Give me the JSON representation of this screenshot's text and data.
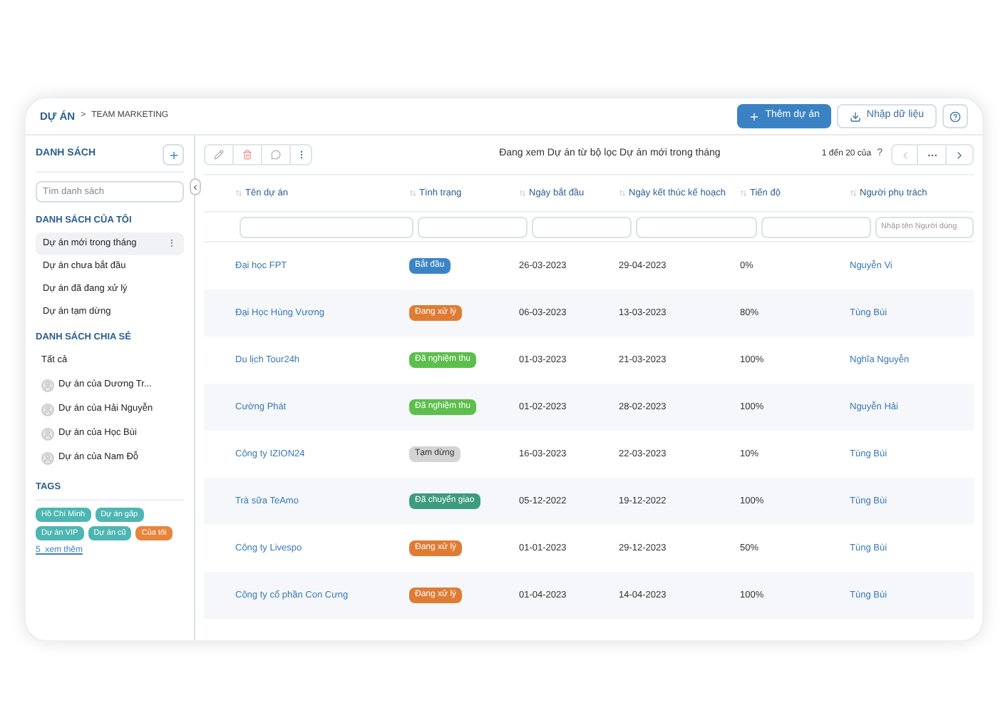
{
  "breadcrumb": {
    "parent": "DỰ ÁN",
    "separator": ">",
    "current": "TEAM MARKETING"
  },
  "header_buttons": [
    {
      "label": "Thêm dự án",
      "kind": "primary"
    },
    {
      "label": "Nhập dữ liệu",
      "kind": "import"
    }
  ],
  "sidebar": {
    "title": "DANH SÁCH",
    "search": {
      "placeholder": "Tìm danh sách"
    },
    "my_lists": {
      "title": "DANH SÁCH CỦA TÔI",
      "items": [
        {
          "label": "Dự án mới trong tháng",
          "selected": true
        },
        {
          "label": "Dự án chưa bắt đầu",
          "selected": false
        },
        {
          "label": "Dự án đã đang xử lý",
          "selected": false
        },
        {
          "label": "Dự án tạm dừng",
          "selected": false
        }
      ]
    },
    "shared_lists": {
      "title": "DANH SÁCH CHIA SẺ",
      "items": [
        {
          "label": "Tất cả",
          "kind": "all"
        },
        {
          "label": "Dự án của Dương Tr...",
          "kind": "user"
        },
        {
          "label": "Dự án của Hải Nguyễn",
          "kind": "user"
        },
        {
          "label": "Dự án của Học Bùi",
          "kind": "user"
        },
        {
          "label": "Dự án của Nam Đỗ",
          "kind": "user"
        }
      ]
    },
    "tags": {
      "title": "TAGS",
      "items": [
        {
          "label": "Hồ Chí Minh",
          "color": "#4db6b2"
        },
        {
          "label": "Dự án gấp",
          "color": "#4db6b2"
        },
        {
          "label": "Dự án VIP",
          "color": "#4db6b2"
        },
        {
          "label": "Dự án cũ",
          "color": "#4db6b2"
        },
        {
          "label": "Của tôi",
          "color": "#e8843c"
        }
      ],
      "more_link": "5  xem thêm"
    }
  },
  "toolbar": {
    "filter_text": "Đang xem Dự án từ bộ lọc Dự án mới trong tháng",
    "pagination": "1 đến 20 của",
    "total": "?"
  },
  "table": {
    "columns": [
      {
        "label": "Tên dự án"
      },
      {
        "label": "Tình trạng"
      },
      {
        "label": "Ngày bắt đầu"
      },
      {
        "label": "Ngày kết thúc kế hoạch"
      },
      {
        "label": "Tiến độ"
      },
      {
        "label": "Người phụ trách",
        "filter_placeholder": "Nhập tên Người dùng"
      }
    ],
    "rows": [
      {
        "name": "Đại học FPT",
        "status": "Bắt đầu",
        "color": "#3b85c6",
        "start": "26-03-2023",
        "end": "29-04-2023",
        "progress": "0%",
        "owner": "Nguyễn Vi"
      },
      {
        "name": "Đại Học Hùng Vương",
        "status": "Đang xử lý",
        "color": "#e07b34",
        "start": "06-03-2023",
        "end": "13-03-2023",
        "progress": "80%",
        "owner": "Tùng Bùi"
      },
      {
        "name": "Du lịch Tour24h",
        "status": "Đã nghiệm thu",
        "color": "#5cbf4c",
        "start": "01-03-2023",
        "end": "21-03-2023",
        "progress": "100%",
        "owner": "Nghĩa Nguyễn"
      },
      {
        "name": "Cường Phát",
        "status": "Đã nghiệm thu",
        "color": "#5cbf4c",
        "start": "01-02-2023",
        "end": "28-02-2023",
        "progress": "100%",
        "owner": "Nguyễn Hải"
      },
      {
        "name": "Công ty IZION24",
        "status": "Tạm dừng",
        "color": "#d4d4d4",
        "start": "16-03-2023",
        "end": "22-03-2023",
        "progress": "10%",
        "owner": "Tùng Bùi"
      },
      {
        "name": "Trà sữa TeAmo",
        "status": "Đã chuyển giao",
        "color": "#3d9c7c",
        "start": "05-12-2022",
        "end": "19-12-2022",
        "progress": "100%",
        "owner": "Tùng Bùi"
      },
      {
        "name": "Công ty Livespo",
        "status": "Đang xử lý",
        "color": "#e07b34",
        "start": "01-01-2023",
        "end": "29-12-2023",
        "progress": "50%",
        "owner": "Tùng Bùi"
      },
      {
        "name": "Công ty cổ phần Con Cưng",
        "status": "Đang xử lý",
        "color": "#e07b34",
        "start": "01-04-2023",
        "end": "14-04-2023",
        "progress": "100%",
        "owner": "Tùng Bùi"
      }
    ]
  }
}
